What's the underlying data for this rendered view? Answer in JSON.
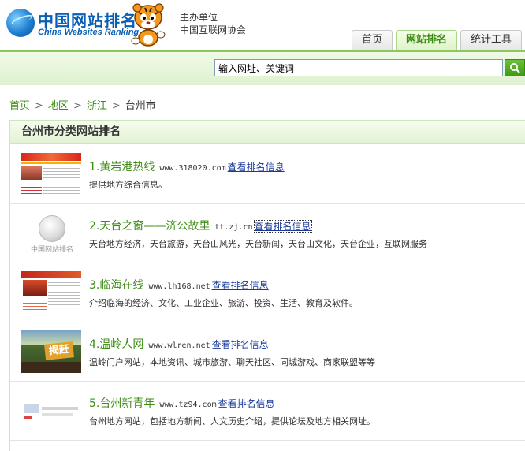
{
  "header": {
    "logo_cn": "中国网站排名",
    "logo_en": "China Websites Ranking",
    "sponsor_line1": "主办单位",
    "sponsor_line2": "中国互联网协会",
    "tabs": [
      {
        "label": "首页",
        "active": false
      },
      {
        "label": "网站排名",
        "active": true
      },
      {
        "label": "统计工具",
        "active": false
      }
    ]
  },
  "search": {
    "value": "输入网址、关键词",
    "button_icon": "search-icon"
  },
  "breadcrumb": {
    "items": [
      "首页",
      "地区",
      "浙江"
    ],
    "current": "台州市"
  },
  "panel": {
    "title": "台州市分类网站排名",
    "rank_link_label": "查看排名信息",
    "items": [
      {
        "name": "1.黄岩港热线",
        "url": "www.318020.com",
        "desc": "提供地方综合信息。"
      },
      {
        "name": "2.天台之窗——济公故里",
        "url": "tt.zj.cn",
        "desc": "天台地方经济，天台旅游，天台山风光，天台新闻，天台山文化，天台企业，互联网服务"
      },
      {
        "name": "3.临海在线",
        "url": "www.lh168.net",
        "desc": "介绍临海的经济、文化、工业企业、旅游、投资、生活、教育及软件。"
      },
      {
        "name": "4.温岭人网",
        "url": "www.wlren.net",
        "desc": "温岭门户网站，本地资讯、城市旅游、聊天社区、同城游戏、商家联盟等等"
      },
      {
        "name": "5.台州新青年",
        "url": "www.tz94.com",
        "desc": "台州地方网站，包括地方新闻、人文历史介绍，提供论坛及地方相关网址。"
      }
    ]
  },
  "thumb_captions": {
    "item2": "中国网站排名",
    "item4": "揭赶"
  },
  "colors": {
    "brand_green": "#3b8c12",
    "link_blue": "#1a3a9a",
    "logo_blue": "#0a5fb4"
  }
}
